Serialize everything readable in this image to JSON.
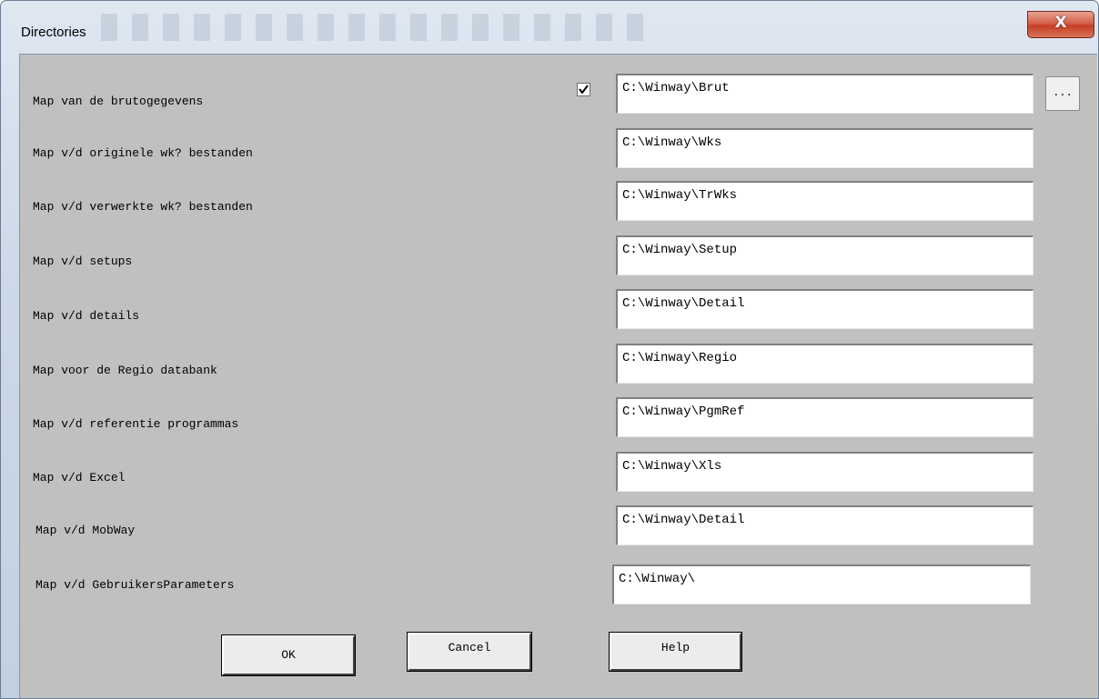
{
  "window": {
    "title": "Directories",
    "close_label": "X"
  },
  "directories": [
    {
      "label": "Map van de brutogegevens",
      "value": "C:\\Winway\\Brut",
      "checked": true
    },
    {
      "label": "Map v/d originele wk? bestanden",
      "value": "C:\\Winway\\Wks"
    },
    {
      "label": "Map v/d verwerkte wk? bestanden",
      "value": "C:\\Winway\\TrWks"
    },
    {
      "label": "Map v/d setups",
      "value": "C:\\Winway\\Setup"
    },
    {
      "label": "Map v/d details",
      "value": "C:\\Winway\\Detail"
    },
    {
      "label": "Map voor de Regio databank",
      "value": "C:\\Winway\\Regio"
    },
    {
      "label": "Map v/d referentie programmas",
      "value": "C:\\Winway\\PgmRef"
    },
    {
      "label": "Map v/d Excel",
      "value": "C:\\Winway\\Xls"
    },
    {
      "label": "Map v/d MobWay",
      "value": "C:\\Winway\\Detail"
    },
    {
      "label": "Map v/d GebruikersParameters",
      "value": "C:\\Winway\\"
    }
  ],
  "browse_label": "...",
  "buttons": {
    "ok": "OK",
    "cancel": "Cancel",
    "help": "Help"
  },
  "colors": {
    "dialog_bg": "#c0c0c0",
    "close_red": "#c53e25"
  }
}
